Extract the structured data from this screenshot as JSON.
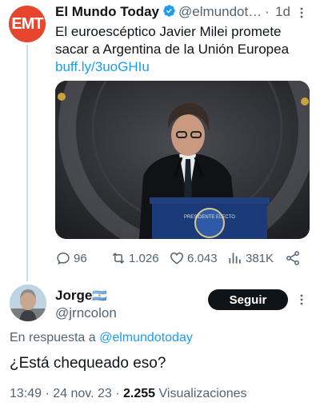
{
  "original_tweet": {
    "avatar_text": "EMT",
    "display_name": "El Mundo Today",
    "handle": "@elmundot…",
    "separator": "·",
    "time": "1d",
    "text": "El euroescéptico Javier Milei promete sacar a Argentina de la Unión Europea",
    "link": "buff.ly/3uoGHIu",
    "stats": {
      "replies": "96",
      "retweets": "1.026",
      "likes": "6.043",
      "views": "381K"
    }
  },
  "reply": {
    "display_name": "Jorge",
    "flag": "🇦🇷",
    "handle": "@jrncolon",
    "follow_label": "Seguir",
    "in_reply_prefix": "En respuesta a",
    "in_reply_handle": "@elmundotoday",
    "text": "¿Está chequeado eso?",
    "timestamp": "13:49 · 24 nov. 23 ·",
    "views_count": "2.255",
    "views_label": "Visualizaciones"
  },
  "colors": {
    "brand": "#e5462d",
    "link": "#1d9bf0",
    "muted": "#536471",
    "text": "#0f1419"
  }
}
